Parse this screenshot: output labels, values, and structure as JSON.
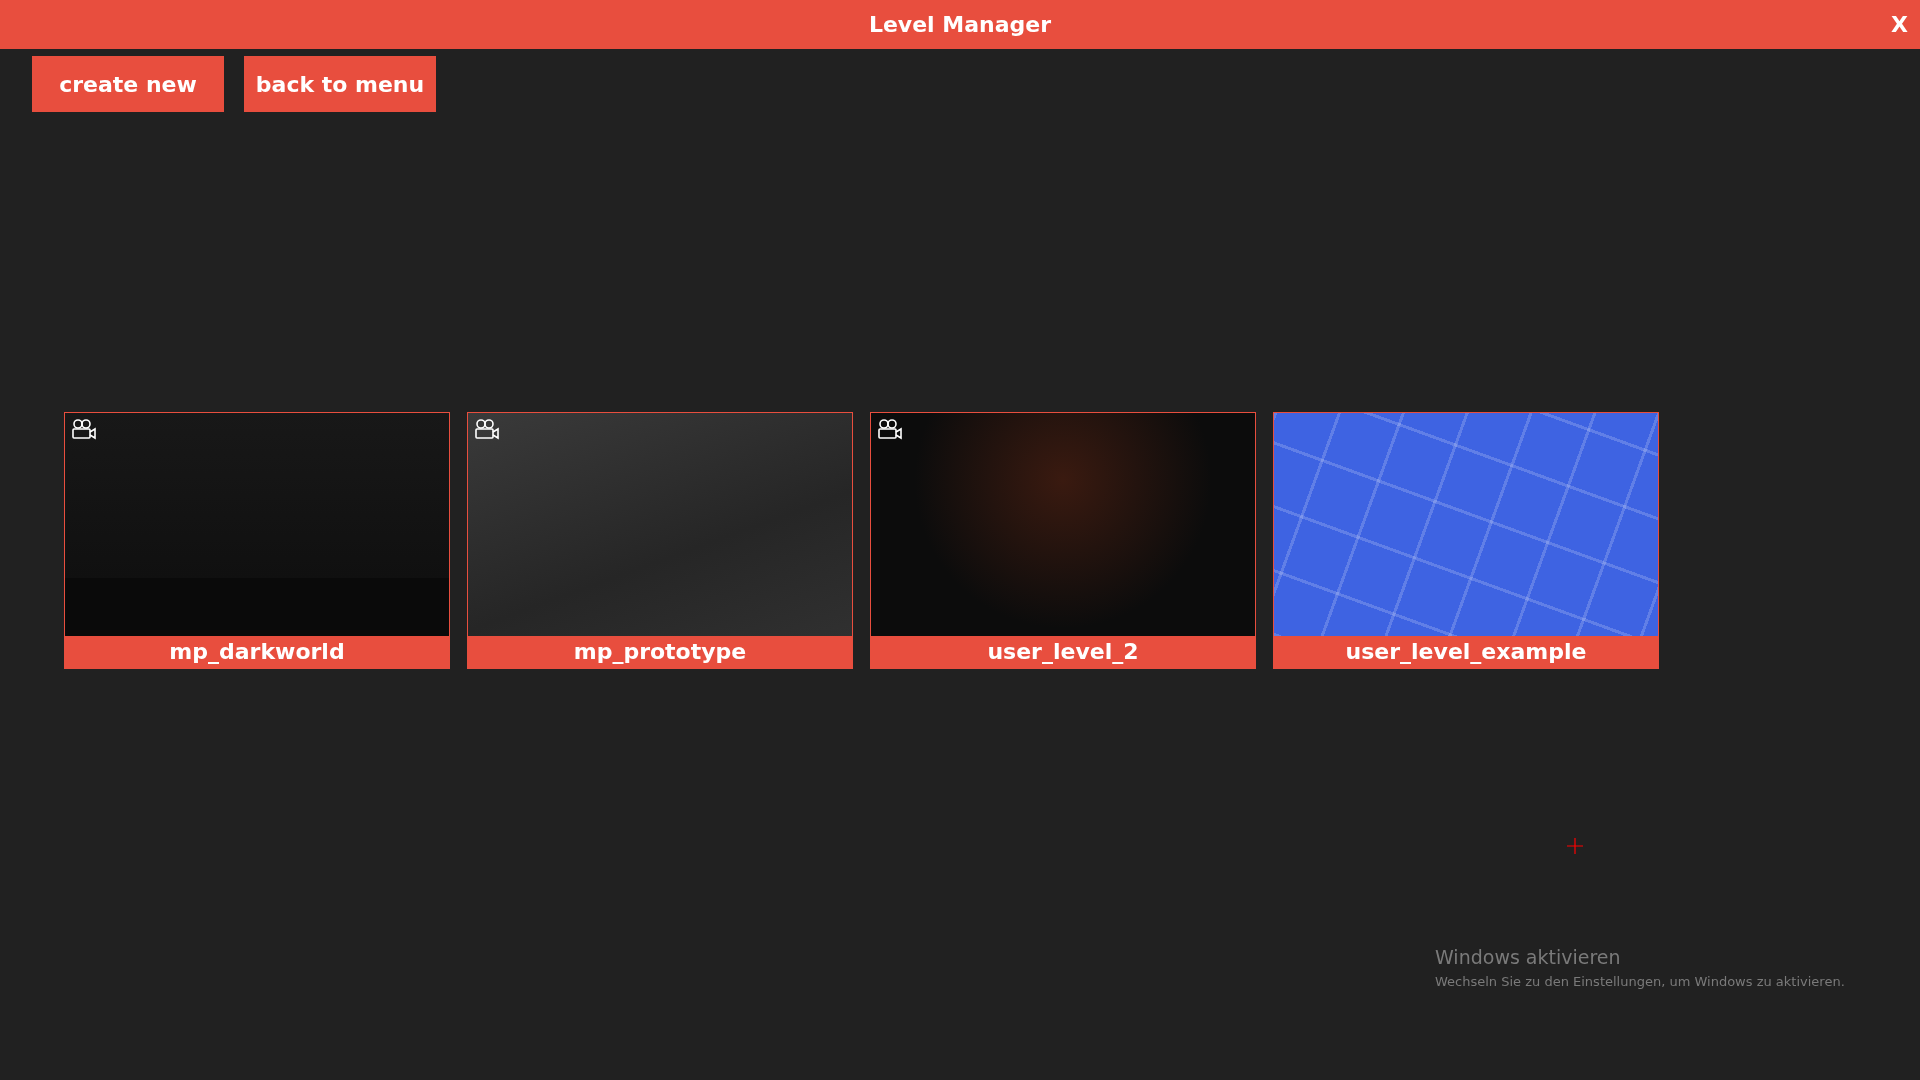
{
  "window": {
    "title": "Level Manager",
    "close": "X"
  },
  "toolbar": {
    "buttons": [
      "create new",
      "back to menu"
    ]
  },
  "levels": [
    {
      "name": "mp_darkworld",
      "kind": "dark",
      "camera_icon": true
    },
    {
      "name": "mp_prototype",
      "kind": "grey",
      "camera_icon": true
    },
    {
      "name": "user_level_2",
      "kind": "room",
      "camera_icon": true
    },
    {
      "name": "user_level_example",
      "kind": "blueprint",
      "camera_icon": false
    }
  ],
  "os_notice": {
    "title": "Windows aktivieren",
    "text": "Wechseln Sie zu den Einstellungen, um Windows zu aktivieren."
  }
}
